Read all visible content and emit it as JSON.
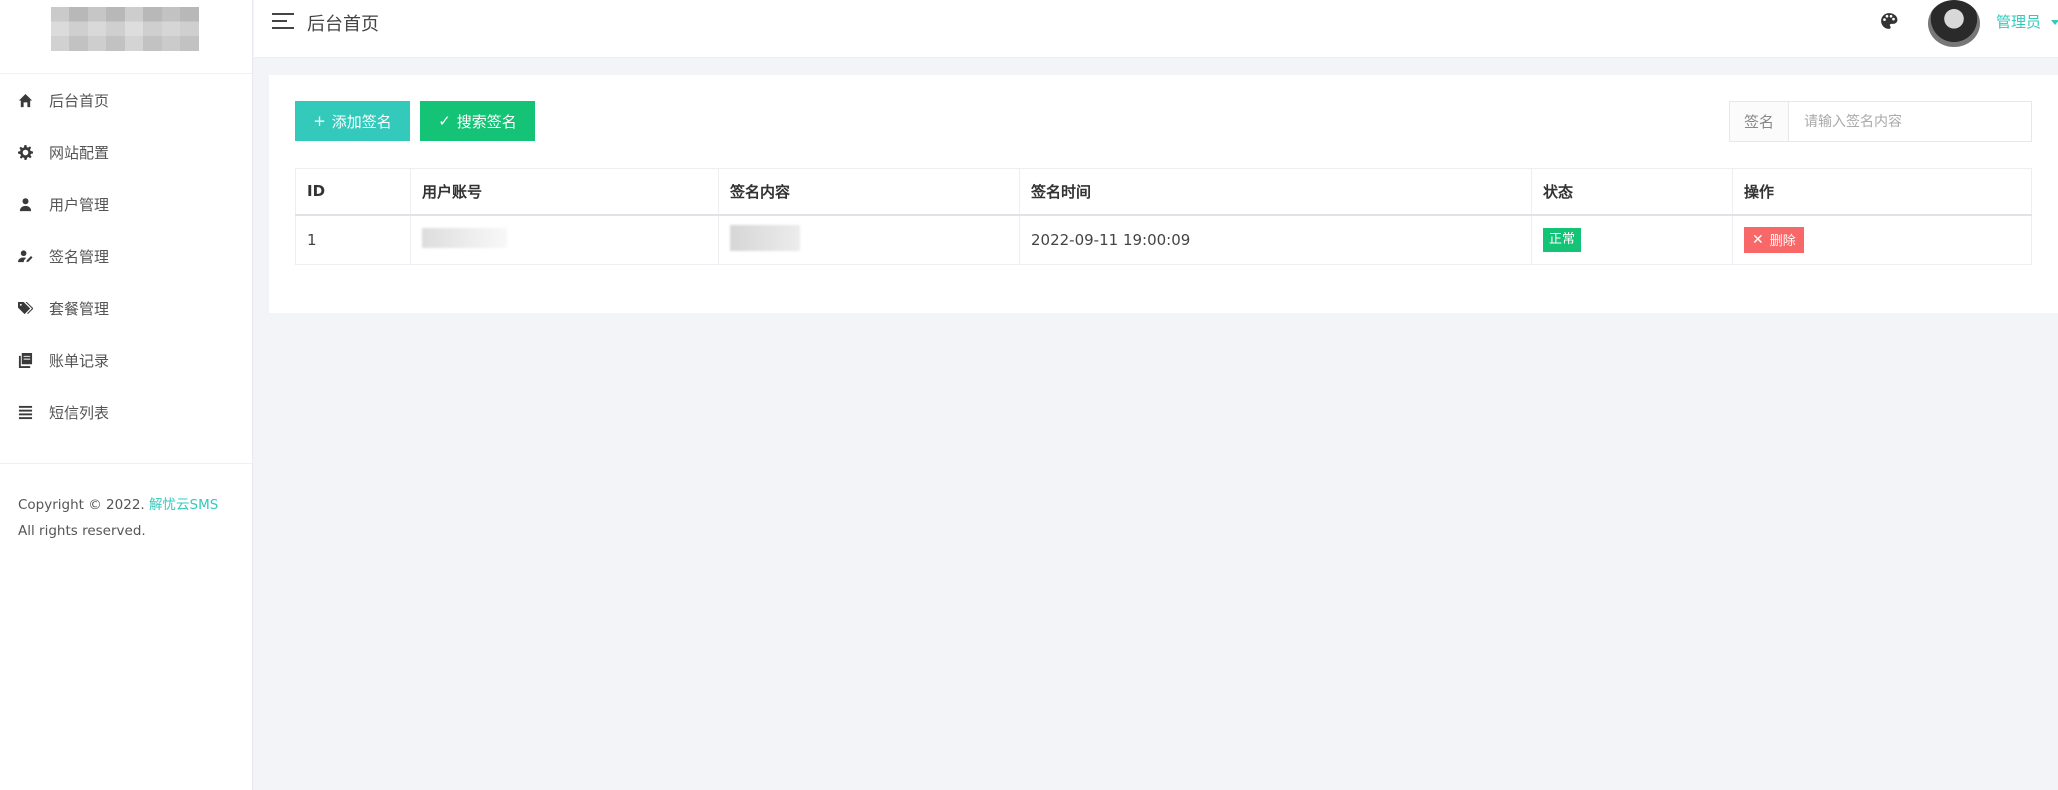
{
  "header": {
    "title": "后台首页",
    "user_name": "管理员"
  },
  "sidebar": {
    "items": [
      {
        "label": "后台首页",
        "icon": "home-icon"
      },
      {
        "label": "网站配置",
        "icon": "gear-icon"
      },
      {
        "label": "用户管理",
        "icon": "user-icon"
      },
      {
        "label": "签名管理",
        "icon": "user-edit-icon"
      },
      {
        "label": "套餐管理",
        "icon": "tags-icon"
      },
      {
        "label": "账单记录",
        "icon": "book-icon"
      },
      {
        "label": "短信列表",
        "icon": "list-icon"
      }
    ],
    "copyright_prefix": "Copyright © 2022.",
    "copyright_brand": "解忧云SMS",
    "copyright_suffix": "All rights reserved."
  },
  "toolbar": {
    "add_label": "添加签名",
    "search_label": "搜索签名"
  },
  "search": {
    "label": "签名",
    "placeholder": "请输入签名内容"
  },
  "table": {
    "headers": [
      "ID",
      "用户账号",
      "签名内容",
      "签名时间",
      "状态",
      "操作"
    ],
    "rows": [
      {
        "id": "1",
        "time": "2022-09-11 19:00:09",
        "status": "正常",
        "action": "删除"
      }
    ]
  },
  "colors": {
    "primary": "#33cabb",
    "success": "#15c377",
    "danger": "#f96868"
  }
}
